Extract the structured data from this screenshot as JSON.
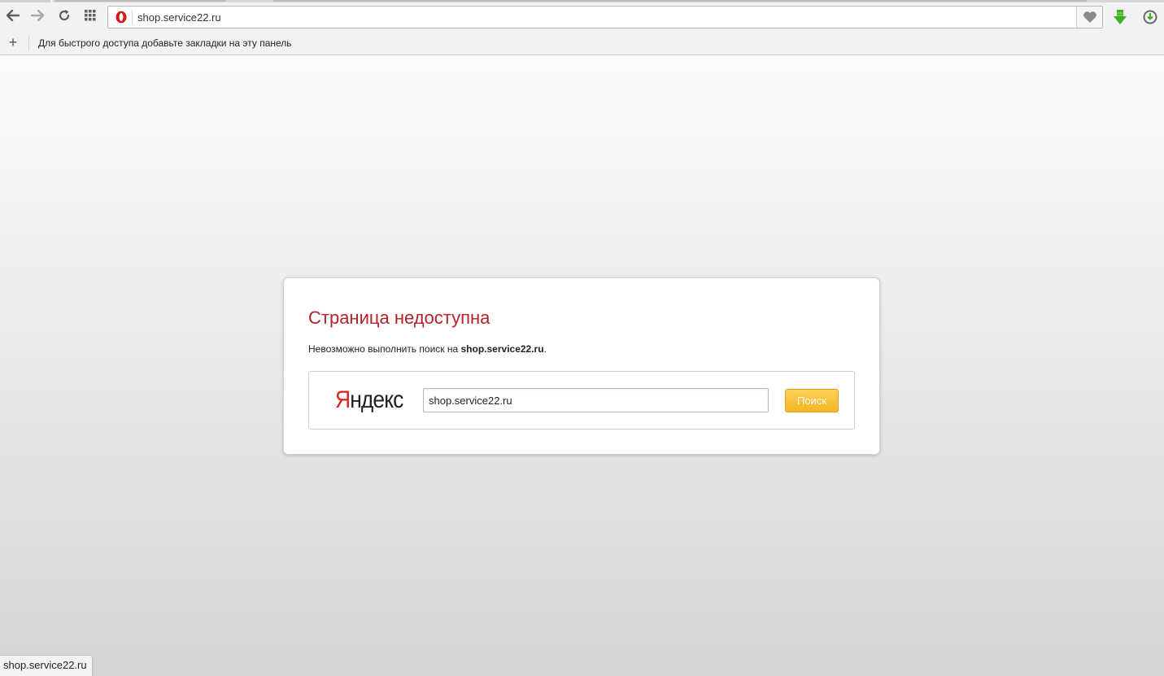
{
  "browser": {
    "address_bar": {
      "value": "shop.service22.ru"
    },
    "bookmarks_bar": {
      "hint": "Для быстрого доступа добавьте закладки на эту панель"
    },
    "icons": {
      "back": "back-arrow-icon",
      "forward": "forward-arrow-icon",
      "reload": "reload-icon",
      "speed_dial": "grid-icon",
      "opera": "opera-logo-icon",
      "stash": "heart-icon",
      "download": "download-arrow-icon",
      "update": "update-icon",
      "add_bookmark": "plus-icon"
    }
  },
  "error_page": {
    "title": "Страница недоступна",
    "message_prefix": "Невозможно выполнить поиск на ",
    "message_host": "shop.service22.ru",
    "message_suffix": ".",
    "search": {
      "logo_first": "Я",
      "logo_rest": "ндекс",
      "query": "shop.service22.ru",
      "button_label": "Поиск"
    }
  },
  "status_bar": {
    "text": "shop.service22.ru"
  },
  "colors": {
    "title_red": "#b3232a",
    "button_orange": "#f4b523",
    "download_green": "#3fae2a",
    "opera_red": "#cc1b1b"
  }
}
